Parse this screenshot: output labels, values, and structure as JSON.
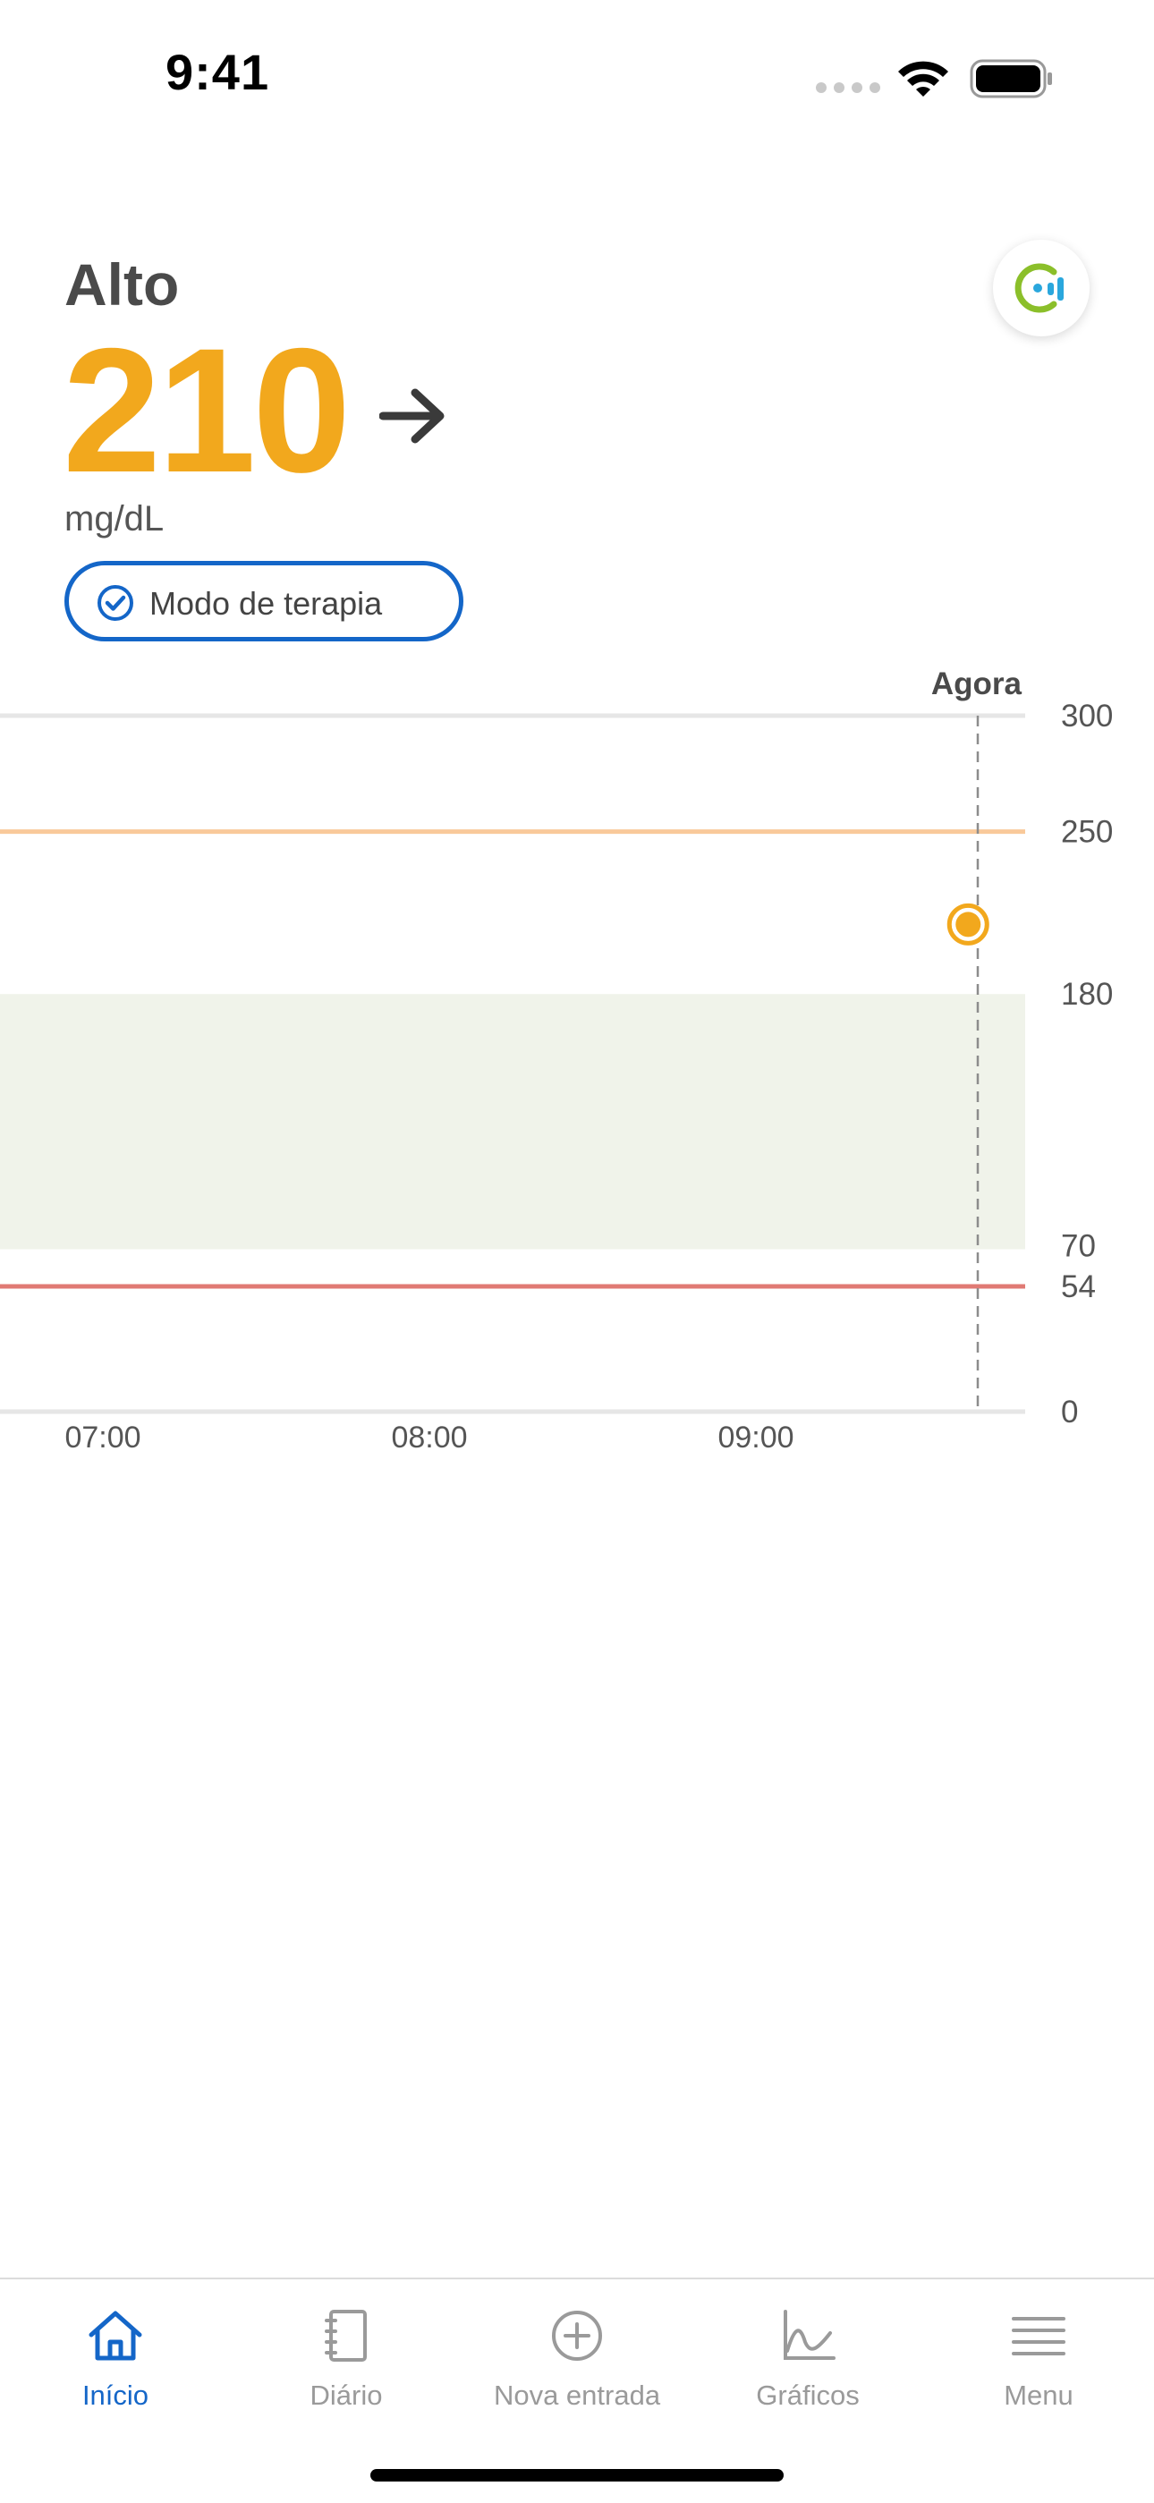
{
  "status_bar": {
    "time": "9:41"
  },
  "header": {
    "state": "Alto",
    "value": "210",
    "unit": "mg/dL",
    "trend_icon": "arrow-right-icon",
    "therapy_mode": "Modo de terapia",
    "brand_icon": "contour-logo-icon"
  },
  "chart_data": {
    "type": "scatter",
    "now_label": "Agora",
    "y_ticks": [
      "300",
      "250",
      "180",
      "70",
      "54",
      "0"
    ],
    "x_ticks": [
      "07:00",
      "08:00",
      "09:00"
    ],
    "ylim": [
      0,
      300
    ],
    "target_range": [
      70,
      180
    ],
    "high_threshold": 250,
    "low_threshold": 54,
    "points": [
      {
        "x": "09:39",
        "y": 210
      }
    ],
    "colors": {
      "point": "#f2a81d",
      "high_line": "#f9c99a",
      "low_line": "#e07a74",
      "target_band": "#f0f3ea"
    }
  },
  "tabbar": {
    "items": [
      {
        "label": "Início",
        "icon": "home-icon",
        "active": true
      },
      {
        "label": "Diário",
        "icon": "notebook-icon",
        "active": false
      },
      {
        "label": "Nova entrada",
        "icon": "plus-circle-icon",
        "active": false
      },
      {
        "label": "Gráficos",
        "icon": "chart-icon",
        "active": false
      },
      {
        "label": "Menu",
        "icon": "menu-icon",
        "active": false
      }
    ]
  },
  "colors": {
    "accent": "#1466c8",
    "high": "#f2a81d"
  }
}
